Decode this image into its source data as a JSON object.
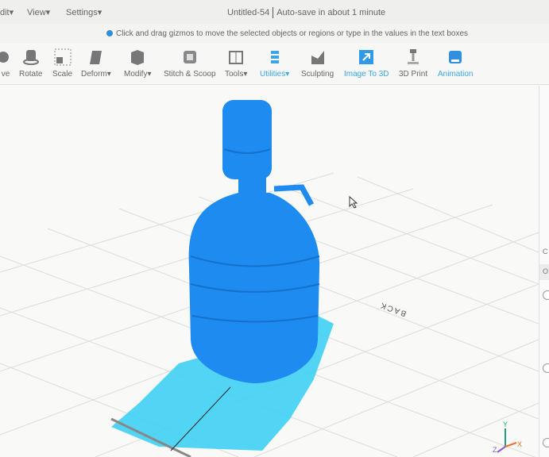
{
  "menubar": {
    "items": [
      "dit",
      "View",
      "Settings"
    ]
  },
  "title": {
    "document": "Untitled-54",
    "autosave": "Auto-save in about 1 minute"
  },
  "hint": {
    "text": "Click and drag gizmos to move the selected objects or regions or type in the values in the text boxes"
  },
  "toolbar": {
    "tools": [
      "ve",
      "Rotate",
      "Scale",
      "Deform",
      "Modify",
      "Stitch & Scoop",
      "Tools",
      "Utilities",
      "Sculpting",
      "Image To 3D",
      "3D Print",
      "Animation"
    ]
  },
  "viewport": {
    "back_label": "BACK",
    "axes": {
      "x": "X",
      "y": "Y",
      "z": "Z"
    }
  },
  "panel": {
    "rows": [
      "C",
      "O"
    ]
  },
  "colors": {
    "model": "#1e8bf0",
    "shadow": "#3fd0f4",
    "accent": "#3ba5e8"
  }
}
